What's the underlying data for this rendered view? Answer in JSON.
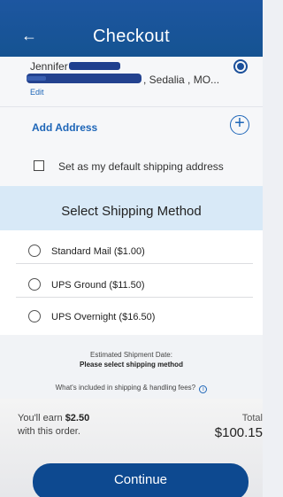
{
  "header": {
    "back_icon": "arrow-left-icon",
    "title": "Checkout"
  },
  "address": {
    "name": "Jennifer",
    "line": ", Sedalia , MO...",
    "edit_label": "Edit",
    "selected": true
  },
  "add_address": {
    "label": "Add Address",
    "icon": "plus-circle-icon"
  },
  "default_shipping": {
    "label": "Set as my default shipping address",
    "checked": false
  },
  "shipping": {
    "title": "Select Shipping Method",
    "options": [
      {
        "label": "Standard Mail ($1.00)",
        "selected": false
      },
      {
        "label": "UPS Ground ($11.50)",
        "selected": false
      },
      {
        "label": "UPS Overnight ($16.50)",
        "selected": false
      }
    ]
  },
  "estimate": {
    "label": "Estimated Shipment Date:",
    "value": "Please select shipping method",
    "fees_text": "What's included in shipping & handling fees?",
    "fees_icon": "info-icon"
  },
  "summary": {
    "earn_prefix": "You'll earn",
    "earn_amount": "$2.50",
    "earn_suffix": "with this order.",
    "total_label": "Total",
    "total_value": "$100.15"
  },
  "actions": {
    "continue_label": "Continue"
  },
  "colors": {
    "header_bg": "#1d56a0",
    "accent": "#1e66b8",
    "section_bg": "#d8e9f7",
    "button_bg": "#0d4990"
  }
}
